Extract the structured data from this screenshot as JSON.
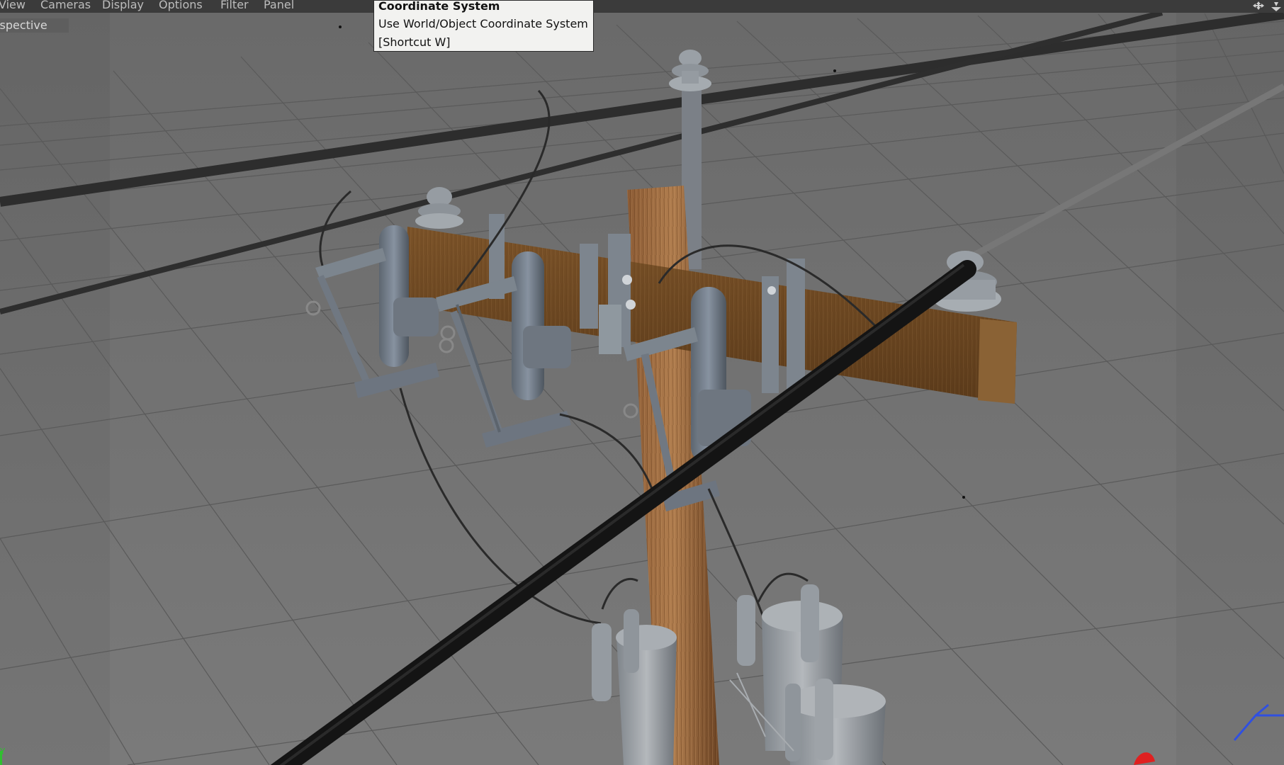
{
  "menu": {
    "items": [
      {
        "label": "View"
      },
      {
        "label": "Cameras"
      },
      {
        "label": "Display"
      },
      {
        "label": "Options"
      },
      {
        "label": "Filter"
      },
      {
        "label": "Panel"
      }
    ]
  },
  "viewport": {
    "label": "Perspective",
    "axis_y_label": "Y"
  },
  "tooltip": {
    "title": "Coordinate System",
    "description": "Use World/Object Coordinate System",
    "shortcut": "[Shortcut W]"
  },
  "icons": {
    "navigation": "move-view-icon",
    "navigation_secondary": "zoom-view-icon"
  },
  "colors": {
    "viewport_background": "#6d6d6d",
    "grid": "#555555",
    "menubar": "#3b3b3b",
    "tooltip_background": "#f2f2f0",
    "axis_x": "#e02020",
    "axis_y": "#30c030",
    "axis_z": "#3050e0"
  }
}
